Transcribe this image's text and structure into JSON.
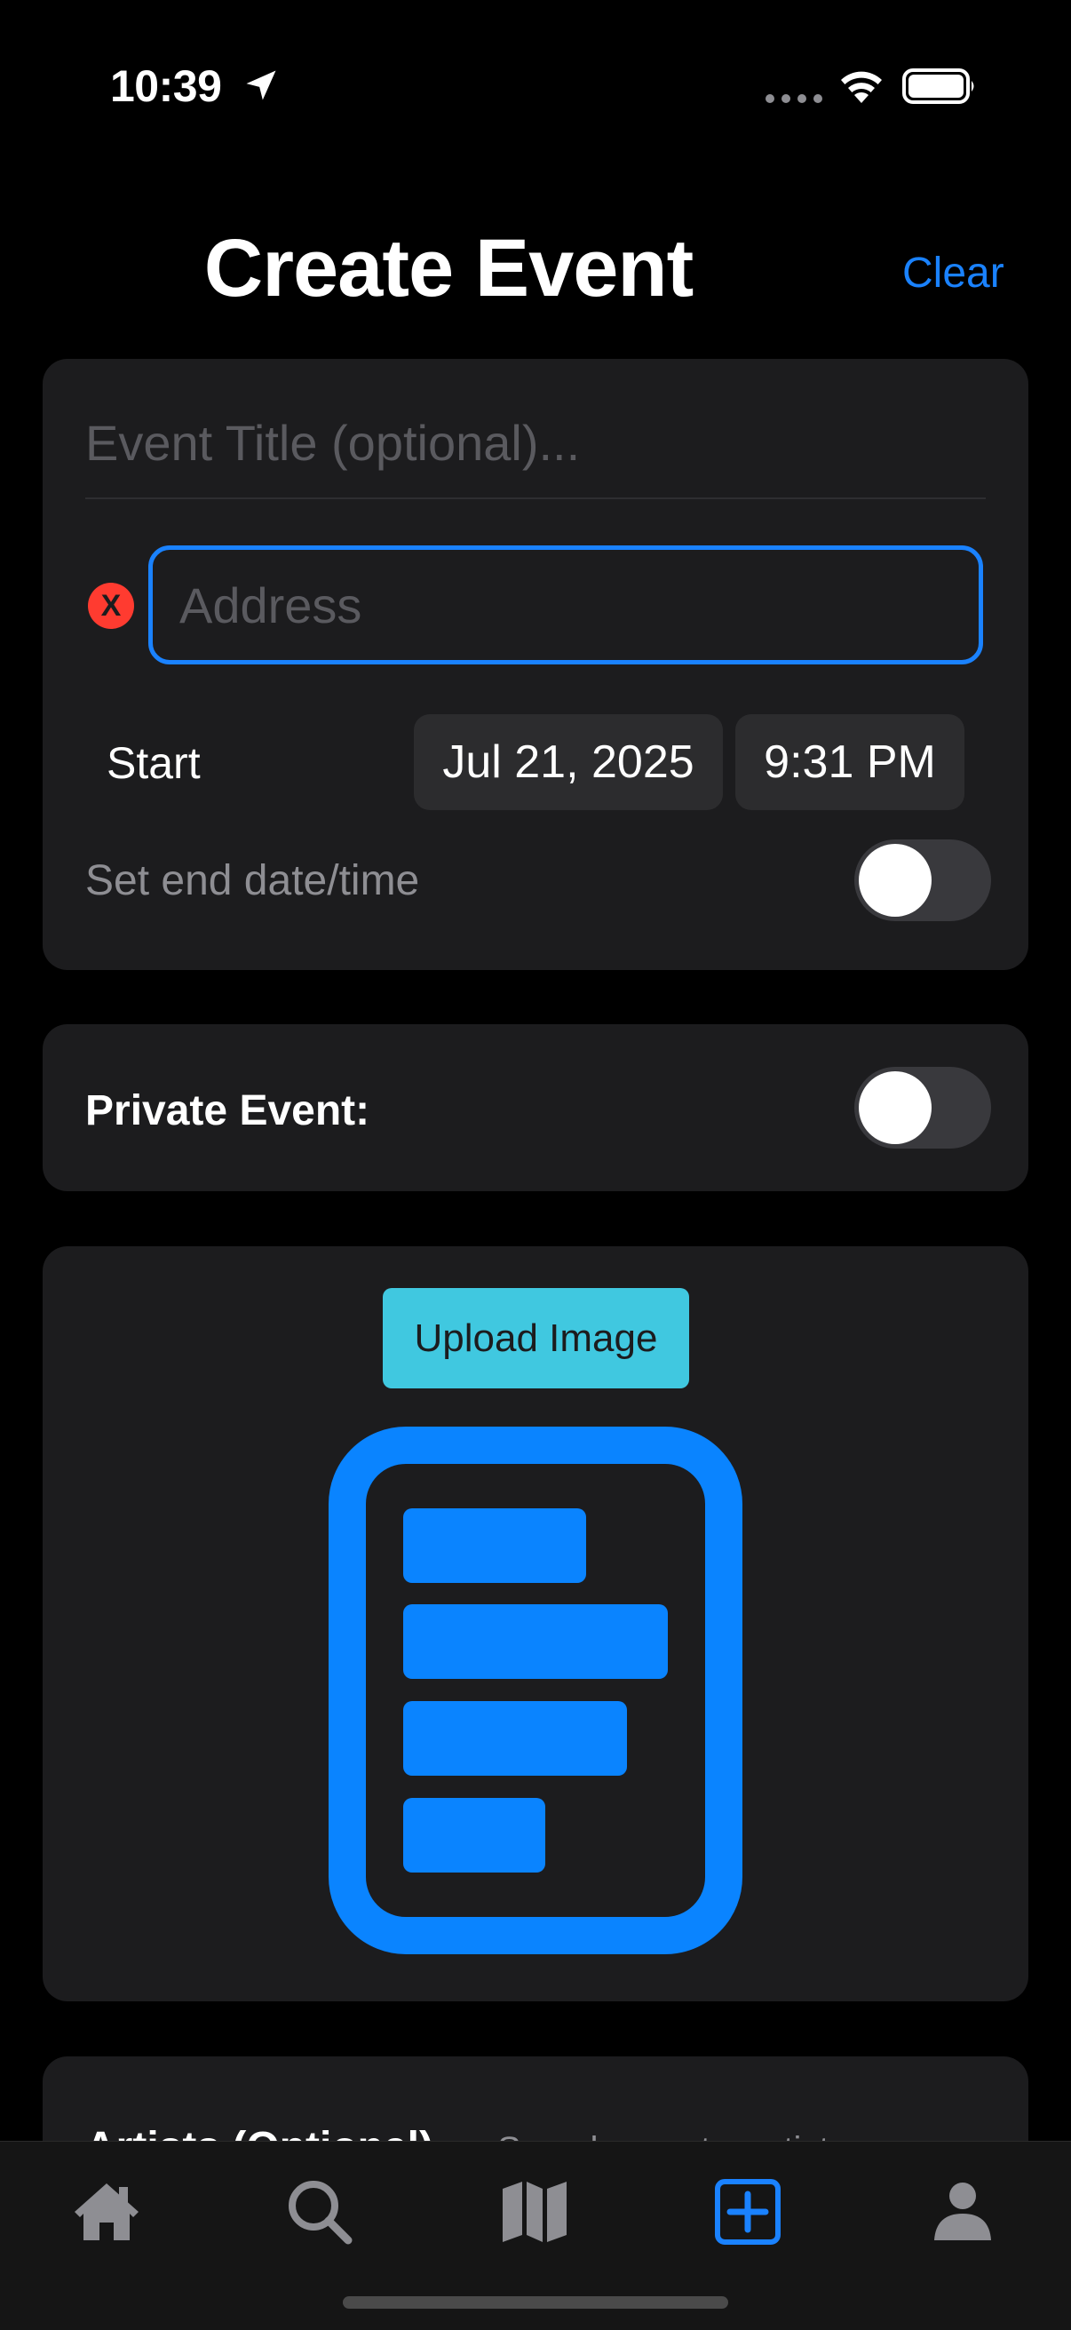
{
  "status_bar": {
    "time": "10:39"
  },
  "header": {
    "title": "Create Event",
    "clear_label": "Clear"
  },
  "event_form": {
    "title_placeholder": "Event Title (optional)...",
    "address_placeholder": "Address",
    "clear_address_glyph": "X",
    "start_label": "Start",
    "start_date": "Jul 21, 2025",
    "start_time": "9:31 PM",
    "end_toggle_label": "Set end date/time",
    "end_toggle_on": false
  },
  "privacy": {
    "label": "Private Event:",
    "toggle_on": false
  },
  "image_section": {
    "upload_label": "Upload Image",
    "placeholder_icon": "document-list-icon"
  },
  "artists": {
    "label": "Artists (Optional)",
    "hint": "Search or enter artist"
  },
  "tabs": [
    {
      "name": "home",
      "icon": "house-icon",
      "selected": false
    },
    {
      "name": "search",
      "icon": "magnifier-icon",
      "selected": false
    },
    {
      "name": "map",
      "icon": "map-icon",
      "selected": false
    },
    {
      "name": "create",
      "icon": "plus-square-icon",
      "selected": true
    },
    {
      "name": "profile",
      "icon": "person-icon",
      "selected": false
    }
  ],
  "colors": {
    "accent": "#1a82ff",
    "upload_button": "#40c8e0",
    "danger": "#ff3b30",
    "card": "#1c1c1e"
  }
}
